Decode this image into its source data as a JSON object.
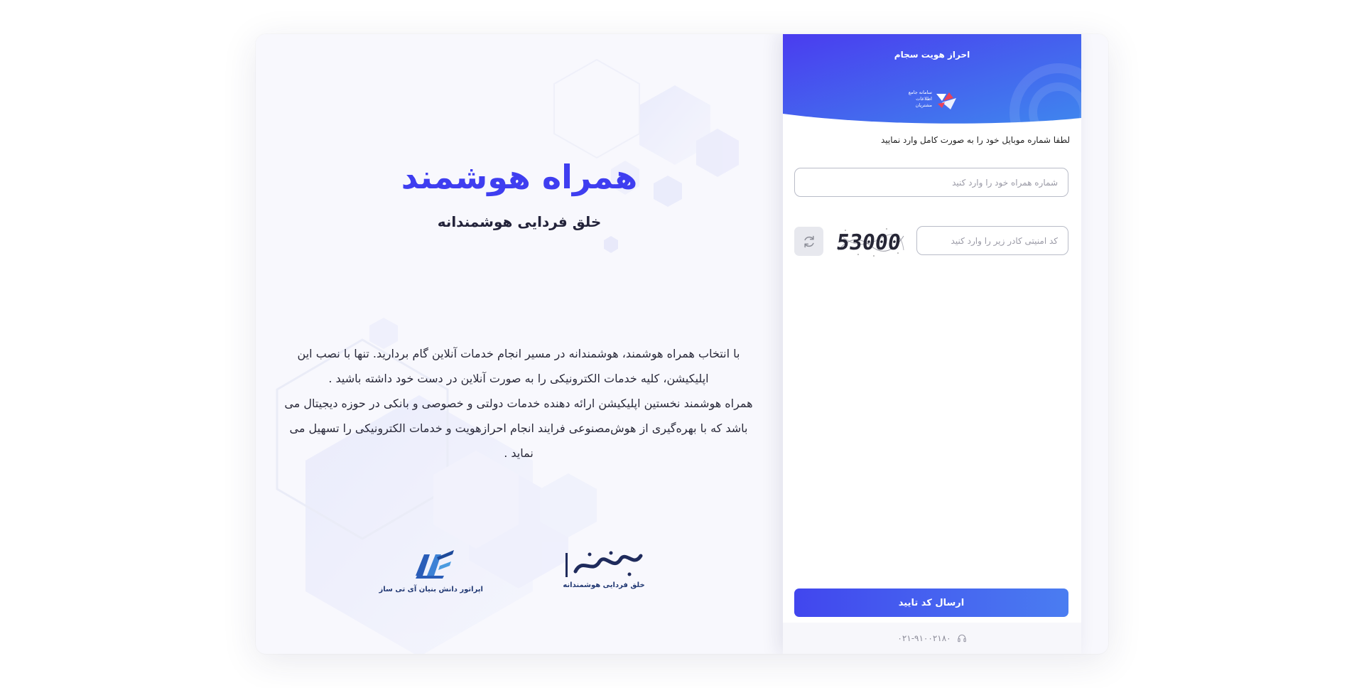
{
  "hero": {
    "title": "همراه هوشمند",
    "subtitle": "خلق فردایی هوشمندانه",
    "description": [
      "با انتخاب همراه هوشمند، هوشمندانه در مسیر انجام خدمات آنلاین گام بردارید. تنها با نصب این اپلیکیشن، کلیه خدمات الکترونیکی را به صورت آنلاین در دست خود داشته باشید .",
      "همراه هوشمند نخستین اپلیکیشن ارائه دهنده خدمات دولتی و خصوصی و بانکی در حوزه دیجیتال می باشد که با بهره‌گیری از هوش‌مصنوعی فرایند انجام احرازهویت و خدمات الکترونیکی را تسهیل می نماید ."
    ]
  },
  "logos": {
    "hamrah": {
      "caption": "خلق فردایی هوشمندانه",
      "mark": "همراه هوشمند"
    },
    "itsaz": {
      "caption": "اپراتور دانش بنیان آی تی ساز",
      "mark": "آی تی ساز"
    }
  },
  "panel": {
    "header_title": "احراز هویت سجام",
    "sajam_logo_text": "سامانه جامع اطلاعات مشتریان",
    "instruction": "لطفا شماره موبایل خود را به صورت کامل وارد نمایید",
    "phone_placeholder": "شماره همراه خود را وارد کنید",
    "captcha_placeholder": "کد امنیتی کادر زیر را وارد کنید",
    "captcha_code": "53000",
    "submit_label": "ارسال کد تایید",
    "support_phone": "۰۲۱-۹۱۰۰۲۱۸۰"
  },
  "icons": {
    "refresh": "refresh-icon",
    "headset": "headset-icon"
  },
  "colors": {
    "brand": "#3f3ef0",
    "header_gradient_start": "#4a3cef",
    "header_gradient_end": "#3f86ee"
  }
}
